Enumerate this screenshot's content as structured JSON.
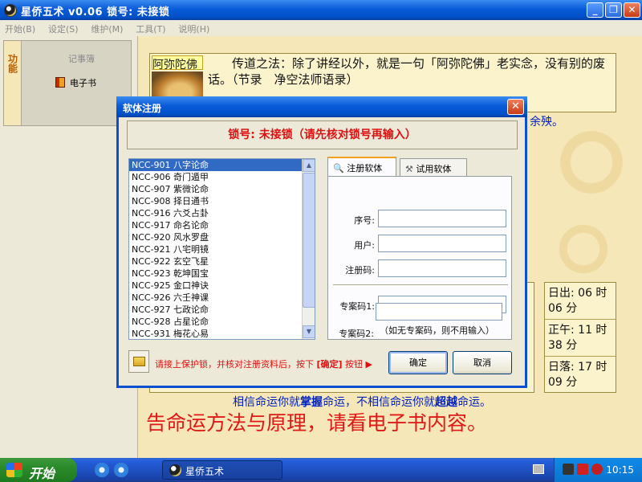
{
  "window": {
    "title": "星侨五术 v0.06  锁号: 未接锁",
    "minimize": "_",
    "maximize": "❐",
    "close": "✕"
  },
  "menu": [
    "开始(B)",
    "设定(S)",
    "维护(M)",
    "工具(T)",
    "说明(H)"
  ],
  "sidebar": {
    "tab_label": "功能",
    "notebook": "记事簿",
    "ebook": "电子书"
  },
  "main": {
    "quote_name": "阿弥陀佛",
    "quote_text": "传道之法：除了讲经以外，就是一句「阿弥陀佛」老实念，没有别的废话。（节录　净空法师语录）",
    "blue_tail": "余殃。",
    "sun": [
      "日出: 06 时 06 分",
      "正午: 11 时 38 分",
      "日落: 17 时 09 分"
    ],
    "motto_pre": "相信命运你就",
    "motto_b1": "掌握",
    "motto_mid": "命运，不相信命运你就",
    "motto_b2": "超越",
    "motto_post": "命运。",
    "bigline": "告命运方法与原理，请看电子书内容。"
  },
  "dialog": {
    "title": "软体注册",
    "close": "✕",
    "lock_status": "锁号: 未接锁（请先核对锁号再输入）",
    "list": [
      "NCC-901 八字论命",
      "NCC-906 奇门遁甲",
      "NCC-907 紫微论命",
      "NCC-908 择日通书",
      "NCC-916 六爻占卦",
      "NCC-917 命名论命",
      "NCC-920 风水罗盘",
      "NCC-921 八宅明镜",
      "NCC-922 玄空飞星",
      "NCC-923 乾坤国宝",
      "NCC-925 金口神诀",
      "NCC-926 六壬神课",
      "NCC-927 七政论命",
      "NCC-928 占星论命",
      "NCC-931 梅花心易"
    ],
    "tab_register": "注册软体",
    "tab_trial": "试用软体",
    "label_serial": "序号:",
    "label_user": "用户:",
    "label_code": "注册码:",
    "label_case1": "专案码1:",
    "label_case2": "专案码2:",
    "hint": "（如无专案码，则不用输入）",
    "bottom_pre": "请接上保护锁，并核对注册资料后，按下 ",
    "bottom_bold": "[确定]",
    "bottom_post": " 按钮 ▶",
    "ok": "确定",
    "cancel": "取消"
  },
  "taskbar": {
    "start": "开始",
    "task": "星侨五术",
    "clock": "10:15"
  }
}
